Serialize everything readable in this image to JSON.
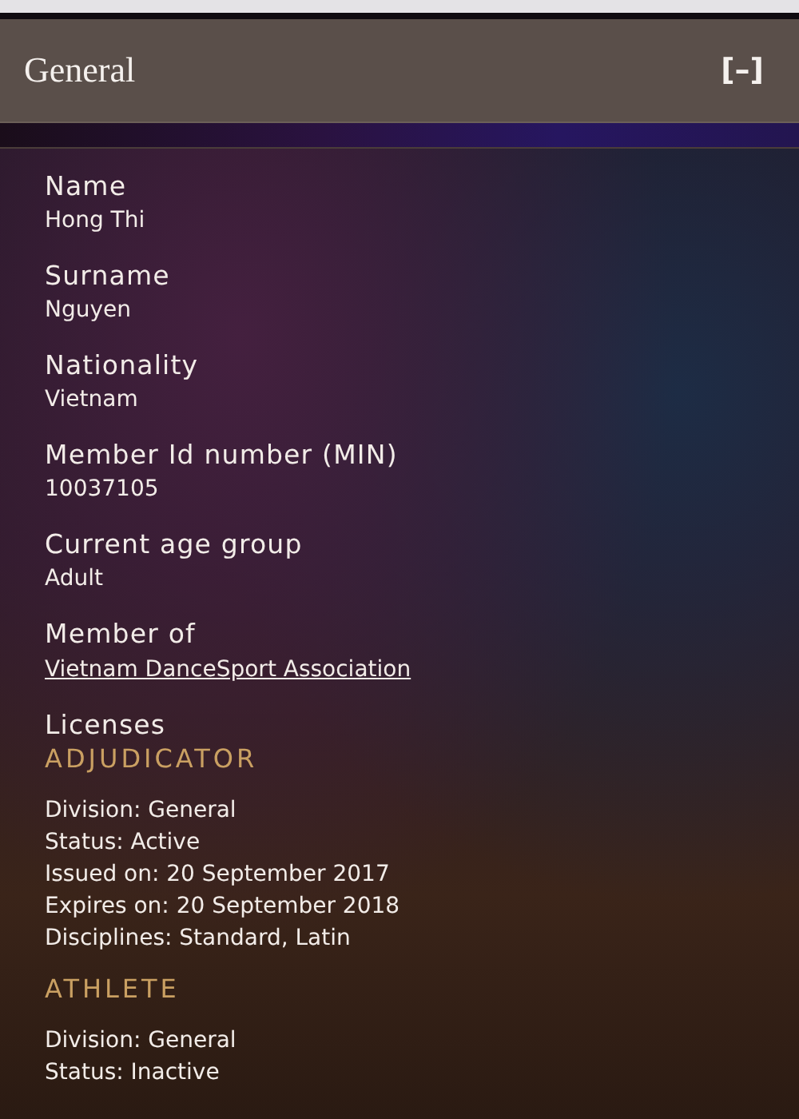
{
  "header": {
    "title": "General",
    "icon_text": "[–]"
  },
  "fields": [
    {
      "label": "Name",
      "value": "Hong Thi",
      "kind": "text"
    },
    {
      "label": "Surname",
      "value": "Nguyen",
      "kind": "text"
    },
    {
      "label": "Nationality",
      "value": "Vietnam",
      "kind": "text"
    },
    {
      "label": "Member Id number (MIN)",
      "value": "10037105",
      "kind": "text"
    },
    {
      "label": "Current age group",
      "value": "Adult",
      "kind": "text"
    },
    {
      "label": "Member of",
      "value": "Vietnam DanceSport Association",
      "kind": "link"
    }
  ],
  "licenses": {
    "label": "Licenses",
    "items": [
      {
        "type": "ADJUDICATOR",
        "lines": [
          "Division: General",
          "Status: Active",
          "Issued on: 20 September 2017",
          "Expires on: 20 September 2018",
          "Disciplines: Standard, Latin"
        ]
      },
      {
        "type": "ATHLETE",
        "lines": [
          "Division: General",
          "Status: Inactive"
        ]
      }
    ]
  }
}
